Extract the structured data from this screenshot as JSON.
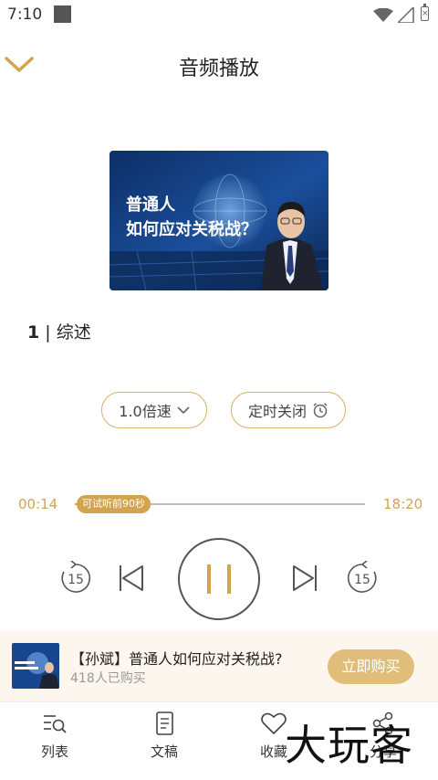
{
  "status": {
    "time": "7:10"
  },
  "header": {
    "title": "音频播放"
  },
  "cover": {
    "headline_line1": "普通人",
    "headline_line2": "如何应对关税战？"
  },
  "chapter": {
    "number": "1",
    "separator": " | ",
    "name": "综述"
  },
  "controls": {
    "speed_label": "1.0倍速",
    "timer_label": "定时关闭",
    "skip_seconds": "15"
  },
  "progress": {
    "current": "00:14",
    "total": "18:20",
    "trial_tip": "可试听前90秒",
    "fraction": 0.013
  },
  "purchase": {
    "title": "【孙斌】普通人如何应对关税战?",
    "count": "418人已购买",
    "button": "立即购买"
  },
  "nav": {
    "list": "列表",
    "doc": "文稿",
    "fav": "收藏",
    "share": "分享"
  },
  "watermark": "大玩客",
  "colors": {
    "accent": "#d2a44e",
    "banner_bg": "#fdf6ee",
    "button": "#e1bd7a"
  }
}
